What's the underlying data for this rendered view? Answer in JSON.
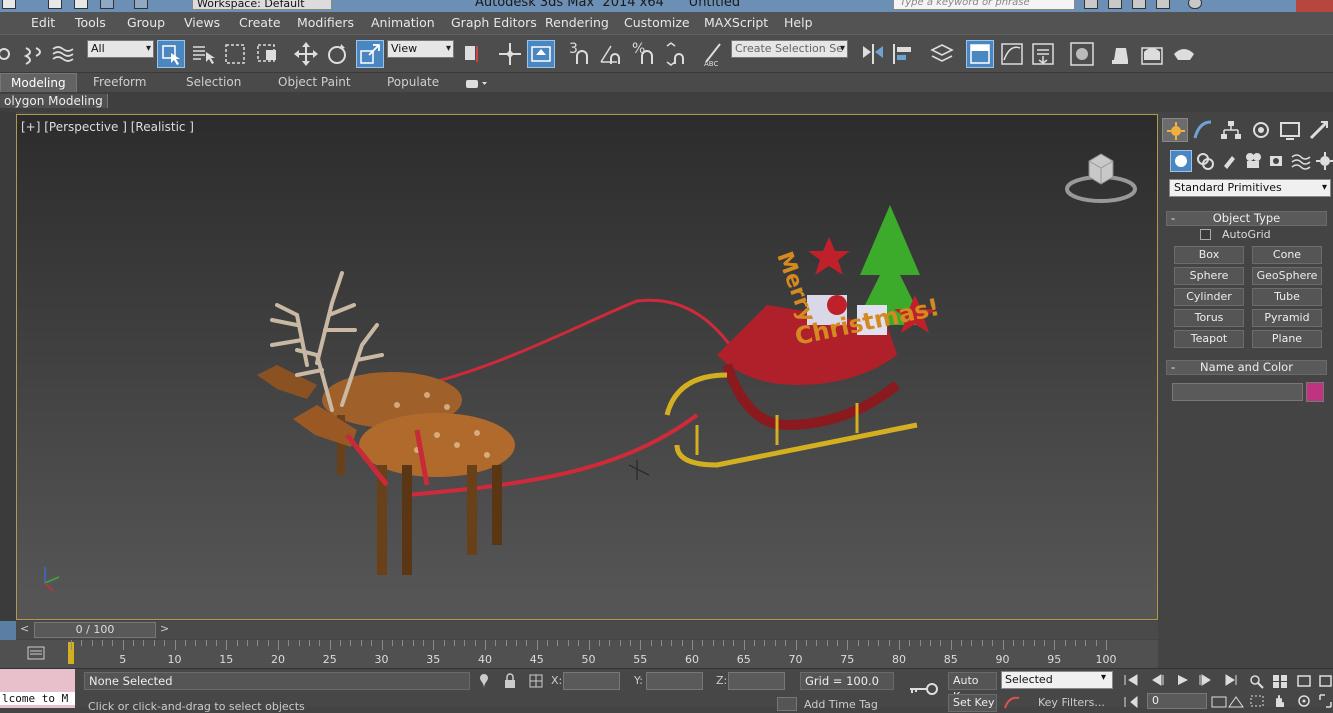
{
  "titlebar": {
    "title": "Autodesk 3ds Max  2014 x64      Untitled",
    "workspace": "Workspace: Default",
    "search_placeholder": "Type a keyword or phrase"
  },
  "menu": [
    "Edit",
    "Tools",
    "Group",
    "Views",
    "Create",
    "Modifiers",
    "Animation",
    "Graph Editors",
    "Rendering",
    "Customize",
    "MAXScript",
    "Help"
  ],
  "toolbar": {
    "selection_filter": "All",
    "reference_coord": "View",
    "named_selection_placeholder": "Create Selection Se",
    "snap_label": "3",
    "angle_snap_label": "%"
  },
  "ribbon": {
    "tabs": [
      "Modeling",
      "Freeform",
      "Selection",
      "Object Paint",
      "Populate"
    ],
    "active_tab": "Modeling",
    "sub_label": "olygon Modeling"
  },
  "viewport": {
    "label": "[+] [Perspective ] [Realistic ]",
    "text_3d": [
      "Merry",
      "Christmas!"
    ]
  },
  "command_panel": {
    "category": "Standard Primitives",
    "object_type_title": "Object Type",
    "autogrid_label": "AutoGrid",
    "primitives": [
      "Box",
      "Cone",
      "Sphere",
      "GeoSphere",
      "Cylinder",
      "Tube",
      "Torus",
      "Pyramid",
      "Teapot",
      "Plane"
    ],
    "name_color_title": "Name and Color",
    "object_color": "#c0337f"
  },
  "timeline": {
    "frame_display": "0 / 100",
    "tick_labels": [
      "5",
      "10",
      "15",
      "20",
      "25",
      "30",
      "35",
      "40",
      "45",
      "50",
      "55",
      "60",
      "65",
      "70",
      "75",
      "80",
      "85",
      "90",
      "95",
      "100"
    ]
  },
  "status": {
    "selection_status": "None Selected",
    "prompt": "Click or click-and-drag to select objects",
    "x_label": "X:",
    "y_label": "Y:",
    "z_label": "Z:",
    "grid": "Grid = 100.0",
    "add_time_tag": "Add Time Tag",
    "auto_key": "Auto Key",
    "set_key": "Set Key",
    "key_mode": "Selected",
    "key_filters": "Key Filters...",
    "current_frame": "0",
    "maxscript_listener": "lcome to M"
  }
}
